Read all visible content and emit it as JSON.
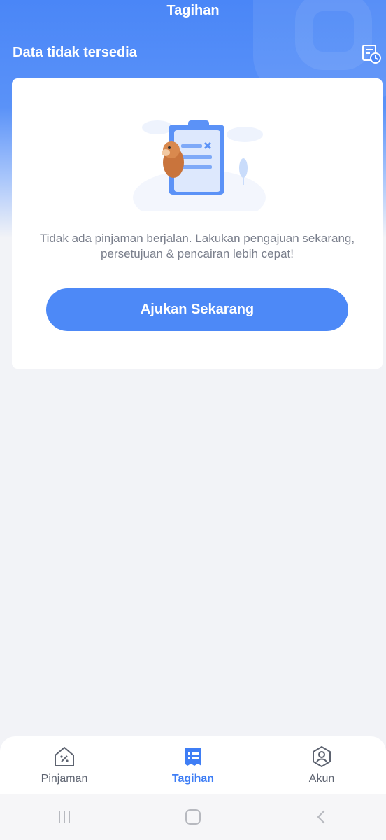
{
  "app": {
    "title": "Tagihan",
    "subheader": "Data tidak tersedia"
  },
  "empty_state": {
    "message_line1": "Tidak ada pinjaman berjalan.  Lakukan pengajuan sekarang,",
    "message_line2": "persetujuan & pencairan lebih cepat!",
    "button_label": "Ajukan Sekarang",
    "illustration": "clipboard-with-mascot"
  },
  "bottom_nav": {
    "items": [
      {
        "label": "Pinjaman",
        "icon": "loan-house-icon",
        "active": false
      },
      {
        "label": "Tagihan",
        "icon": "bill-icon",
        "active": true
      },
      {
        "label": "Akun",
        "icon": "account-icon",
        "active": false
      }
    ]
  },
  "system_nav": {
    "icons": [
      "recent-apps-icon",
      "home-icon",
      "back-icon"
    ]
  },
  "colors": {
    "primary": "#4d89f7",
    "active_nav": "#3f7ef5",
    "background": "#f2f3f7",
    "text_muted": "#7a7f8c"
  }
}
